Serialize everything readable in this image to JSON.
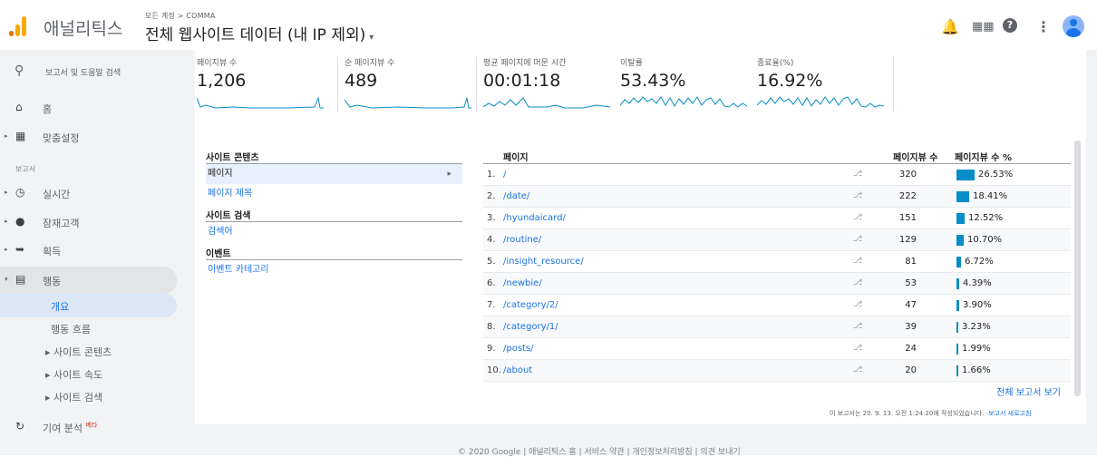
{
  "header": {
    "app_title": "애널리틱스",
    "breadcrumb": "모든 계정 > COMMA",
    "view_title": "전체 웹사이트 데이터 (내 IP 제외)",
    "caret": "▾"
  },
  "sidebar": {
    "search_placeholder": "보고서 및 도움말 검색",
    "home": "홈",
    "custom": "맞춤설정",
    "section_label": "보고서",
    "realtime": "실시간",
    "audience": "잠재고객",
    "acquisition": "획득",
    "behavior": "행동",
    "overview": "개요",
    "behavior_flow": "행동 흐름",
    "site_content": "▸ 사이트 콘텐츠",
    "site_speed": "▸ 사이트 속도",
    "site_search": "▸ 사이트 검색",
    "attribution": "기여 분석",
    "beta": "베타"
  },
  "metrics": [
    {
      "label": "페이지뷰 수",
      "value": "1,206"
    },
    {
      "label": "순 페이지뷰 수",
      "value": "489"
    },
    {
      "label": "평균 페이지에 머문 시간",
      "value": "00:01:18"
    },
    {
      "label": "이탈률",
      "value": "53.43%"
    },
    {
      "label": "종료율(%)",
      "value": "16.92%"
    }
  ],
  "left_panel": {
    "site_content_head": "사이트 콘텐츠",
    "page": "페이지",
    "page_title": "페이지 제목",
    "site_search_head": "사이트 검색",
    "search_term": "검색어",
    "events_head": "이벤트",
    "event_category": "이벤트 카테고리"
  },
  "table": {
    "col_page": "페이지",
    "col_views": "페이지뷰 수",
    "col_pct": "페이지뷰 수 %",
    "rows": [
      {
        "num": "1.",
        "page": "/",
        "views": "320",
        "pct": "26.53%",
        "share": 26.53
      },
      {
        "num": "2.",
        "page": "/date/",
        "views": "222",
        "pct": "18.41%",
        "share": 18.41
      },
      {
        "num": "3.",
        "page": "/hyundaicard/",
        "views": "151",
        "pct": "12.52%",
        "share": 12.52
      },
      {
        "num": "4.",
        "page": "/routine/",
        "views": "129",
        "pct": "10.70%",
        "share": 10.7
      },
      {
        "num": "5.",
        "page": "/insight_resource/",
        "views": "81",
        "pct": "6.72%",
        "share": 6.72
      },
      {
        "num": "6.",
        "page": "/newbie/",
        "views": "53",
        "pct": "4.39%",
        "share": 4.39
      },
      {
        "num": "7.",
        "page": "/category/2/",
        "views": "47",
        "pct": "3.90%",
        "share": 3.9
      },
      {
        "num": "8.",
        "page": "/category/1/",
        "views": "39",
        "pct": "3.23%",
        "share": 3.23
      },
      {
        "num": "9.",
        "page": "/posts/",
        "views": "24",
        "pct": "1.99%",
        "share": 1.99
      },
      {
        "num": "10.",
        "page": "/about",
        "views": "20",
        "pct": "1.66%",
        "share": 1.66
      }
    ],
    "full_report": "전체 보고서 보기"
  },
  "footnote": {
    "text": "이 보고서는 20. 9. 13. 오전 1:24:20에 작성되었습니다. -",
    "refresh": "보고서 새로고침"
  },
  "footer": "© 2020 Google | 애널리틱스 홈 | 서비스 약관 | 개인정보처리방침 | 의견 보내기",
  "colors": {
    "accent": "#1a73e8",
    "bar": "#058dc7",
    "logo": "#f9ab00"
  }
}
